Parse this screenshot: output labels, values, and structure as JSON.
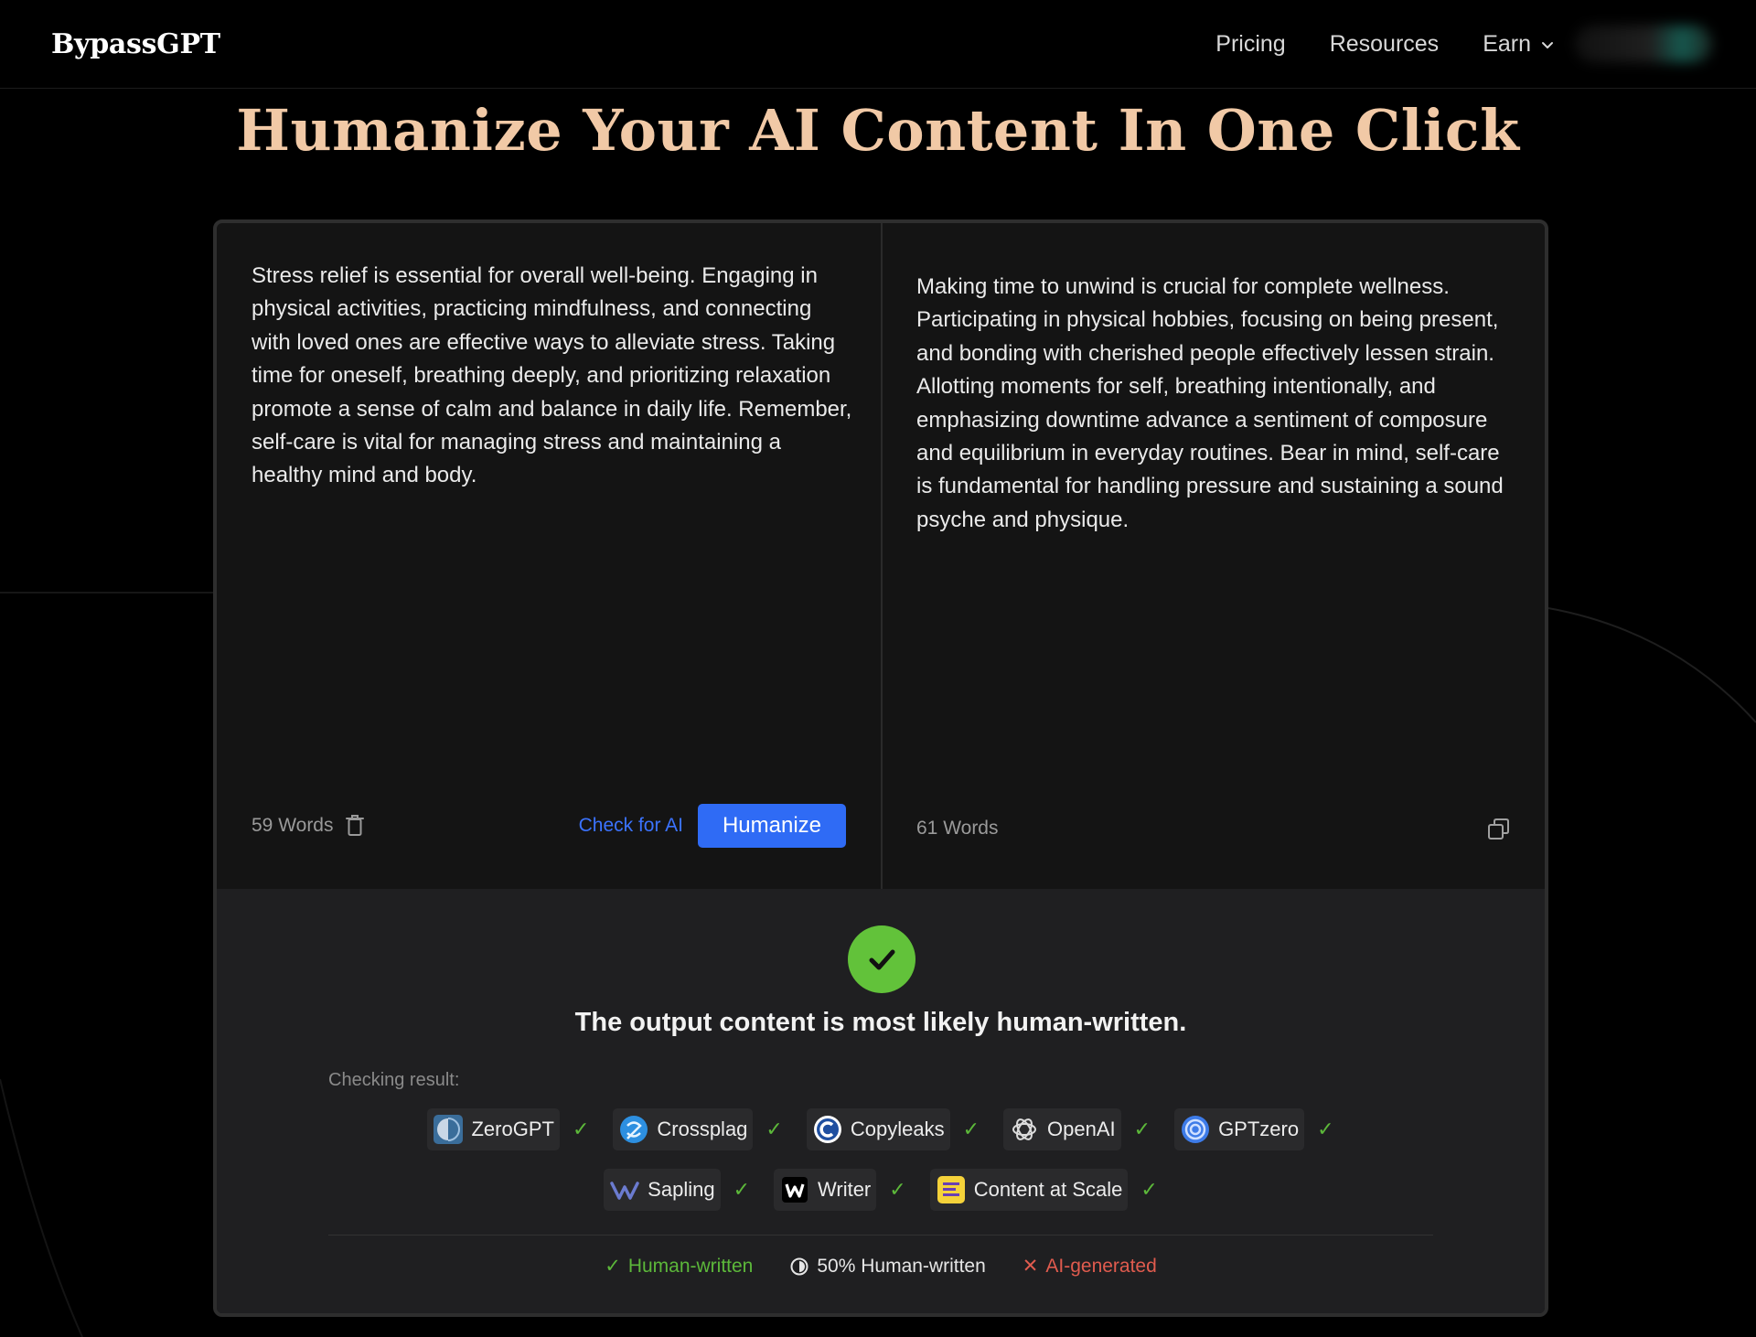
{
  "header": {
    "logo": "BypassGPT",
    "nav": {
      "pricing": "Pricing",
      "resources": "Resources",
      "earn": "Earn"
    }
  },
  "hero": {
    "title": "Humanize Your AI Content In One Click"
  },
  "input": {
    "text": "Stress relief is essential for overall well-being. Engaging in physical activities, practicing mindfulness, and connecting with loved ones are effective ways to alleviate stress. Taking time for oneself, breathing deeply, and prioritizing relaxation promote a sense of calm and balance in daily life. Remember, self-care is vital for managing stress and maintaining a healthy mind and body.",
    "word_count": "59 Words",
    "check_label": "Check for AI",
    "humanize_label": "Humanize"
  },
  "output": {
    "text": "Making time to unwind is crucial for complete wellness. Participating in physical hobbies, focusing on being present, and bonding with cherished people effectively lessen strain. Allotting moments for self, breathing intentionally, and emphasizing downtime advance a sentiment of composure and equilibrium in everyday routines. Bear in mind, self-care is fundamental for handling pressure and sustaining a sound psyche and physique.",
    "word_count": "61 Words"
  },
  "result": {
    "message": "The output content is most likely human-written.",
    "checking_label": "Checking result:",
    "detectors": [
      {
        "name": "ZeroGPT",
        "icon": "zerogpt-logo",
        "status": "human"
      },
      {
        "name": "Crossplag",
        "icon": "crossplag-logo",
        "status": "human"
      },
      {
        "name": "Copyleaks",
        "icon": "copyleaks-logo",
        "status": "human"
      },
      {
        "name": "OpenAI",
        "icon": "openai-logo",
        "status": "human"
      },
      {
        "name": "GPTzero",
        "icon": "gptzero-logo",
        "status": "human"
      },
      {
        "name": "Sapling",
        "icon": "sapling-logo",
        "status": "human"
      },
      {
        "name": "Writer",
        "icon": "writer-logo",
        "status": "human"
      },
      {
        "name": "Content at Scale",
        "icon": "content-at-scale-logo",
        "status": "human"
      }
    ],
    "legend": {
      "human": "Human-written",
      "half": "50% Human-written",
      "ai": "AI-generated"
    }
  },
  "colors": {
    "title": "#f1c9a6",
    "accent": "#2f6bf5",
    "success": "#62c23a",
    "error": "#e05b4e"
  }
}
